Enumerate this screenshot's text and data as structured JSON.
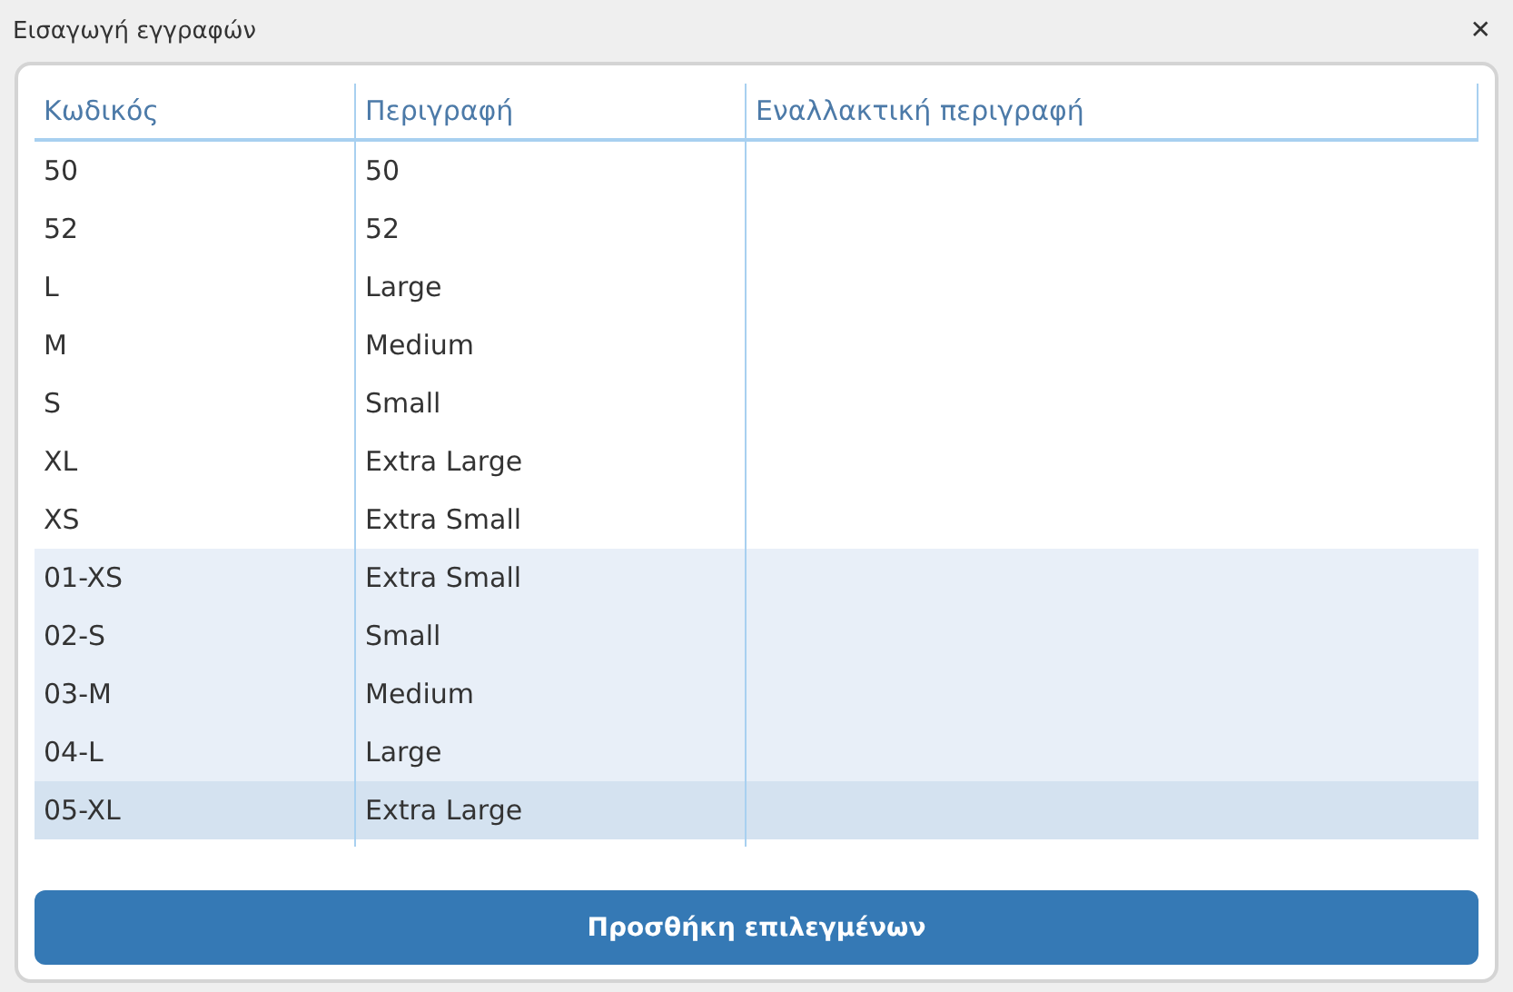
{
  "window": {
    "title": "Εισαγωγή εγγραφών",
    "close": "✕"
  },
  "table": {
    "columns": [
      "Κωδικός",
      "Περιγραφή",
      "Εναλλακτική περιγραφή"
    ],
    "rows": [
      {
        "cells": [
          "50",
          "50",
          ""
        ],
        "selected": false,
        "focused": false
      },
      {
        "cells": [
          "52",
          "52",
          ""
        ],
        "selected": false,
        "focused": false
      },
      {
        "cells": [
          "L",
          "Large",
          ""
        ],
        "selected": false,
        "focused": false
      },
      {
        "cells": [
          "M",
          "Medium",
          ""
        ],
        "selected": false,
        "focused": false
      },
      {
        "cells": [
          "S",
          "Small",
          ""
        ],
        "selected": false,
        "focused": false
      },
      {
        "cells": [
          "XL",
          "Extra Large",
          ""
        ],
        "selected": false,
        "focused": false
      },
      {
        "cells": [
          "XS",
          "Extra Small",
          ""
        ],
        "selected": false,
        "focused": false
      },
      {
        "cells": [
          "01-XS",
          "Extra Small",
          ""
        ],
        "selected": true,
        "focused": false
      },
      {
        "cells": [
          "02-S",
          "Small",
          ""
        ],
        "selected": true,
        "focused": false
      },
      {
        "cells": [
          "03-M",
          "Medium",
          ""
        ],
        "selected": true,
        "focused": false
      },
      {
        "cells": [
          "04-L",
          "Large",
          ""
        ],
        "selected": true,
        "focused": false
      },
      {
        "cells": [
          "05-XL",
          "Extra Large",
          ""
        ],
        "selected": true,
        "focused": true
      }
    ]
  },
  "add_button": "Προσθήκη επιλεγμένων"
}
